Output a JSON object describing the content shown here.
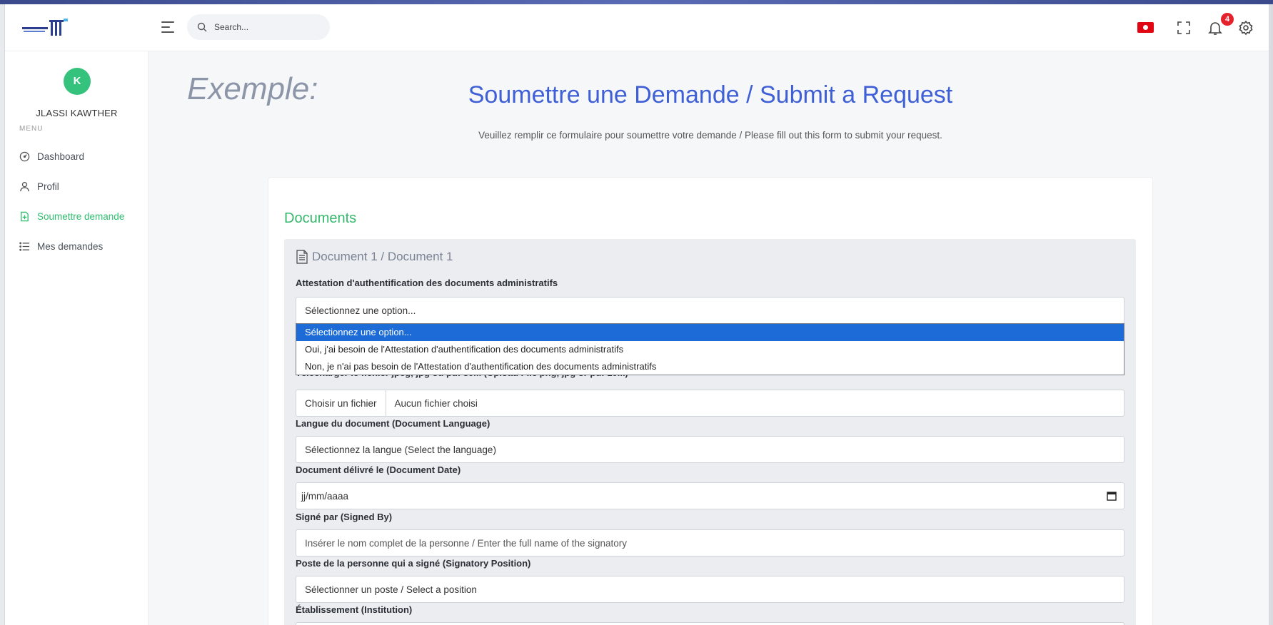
{
  "header": {
    "search_placeholder": "Search...",
    "notification_count": "4",
    "icons": [
      "menu-icon",
      "search-icon",
      "flag-icon",
      "fullscreen-icon",
      "bell-icon",
      "gear-icon"
    ]
  },
  "sidebar": {
    "avatar_initial": "K",
    "username": "JLASSI KAWTHER",
    "menu_label": "MENU",
    "items": [
      {
        "label": "Dashboard",
        "icon": "gauge-icon",
        "active": false
      },
      {
        "label": "Profil",
        "icon": "user-icon",
        "active": false
      },
      {
        "label": "Soumettre demande",
        "icon": "file-plus-icon",
        "active": true
      },
      {
        "label": "Mes demandes",
        "icon": "list-icon",
        "active": false
      }
    ]
  },
  "main": {
    "example_text": "Exemple:",
    "title": "Soumettre une Demande / Submit a Request",
    "subtitle": "Veuillez remplir ce formulaire pour soumettre votre demande / Please fill out this form to submit your request.",
    "section_title": "Documents",
    "document": {
      "heading": "Document 1 / Document 1",
      "attestation_label": "Attestation d'authentification des documents administratifs",
      "attestation_value": "Sélectionnez une option...",
      "attestation_options": [
        "Sélectionnez une option...",
        "Oui, j'ai besoin de l'Attestation d'authentification des documents administratifs",
        "Non, je n'ai pas besoin de l'Attestation d'authentification des documents administratifs"
      ],
      "upload_label": "Télécharger le fichier jpeg, jpg ou pdf 30M (Upload File png, jpg or pdf 10M)",
      "upload_button": "Choisir un fichier",
      "upload_status": "Aucun fichier choisi",
      "language_label": "Langue du document (Document Language)",
      "language_value": "Sélectionnez la langue (Select the language)",
      "date_label": "Document délivré le (Document Date)",
      "date_value": "jj/mm/aaaa",
      "signed_label": "Signé par (Signed By)",
      "signed_placeholder": "Insérer le nom complet de la personne / Enter the full name of the signatory",
      "position_label": "Poste de la personne qui a signé (Signatory Position)",
      "position_value": "Sélectionner un poste / Select a position",
      "institution_label": "Établissement (Institution)"
    }
  },
  "colors": {
    "accent_blue": "#3e5fd6",
    "accent_green": "#35b86c",
    "selected_option": "#1c6bd6",
    "badge_red": "#e5222b"
  }
}
